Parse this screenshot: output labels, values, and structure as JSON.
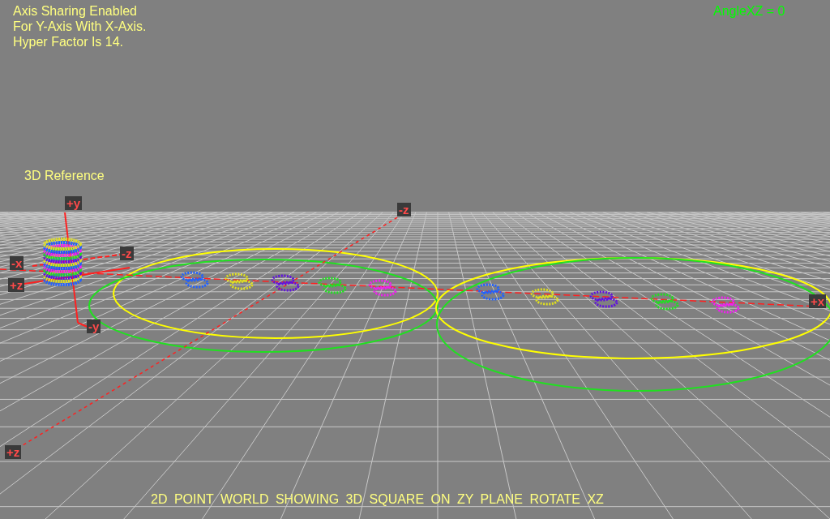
{
  "info_lines": [
    "Axis Sharing Enabled",
    "For Y-Axis With X-Axis.",
    "Hyper Factor Is 14."
  ],
  "angle_label": "AngleXZ = 0",
  "reference_label": "3D Reference",
  "axis_labels": [
    {
      "text": "+y"
    },
    {
      "text": "-z"
    },
    {
      "text": "-x"
    },
    {
      "text": "+z"
    },
    {
      "text": "-y"
    },
    {
      "text": "-z"
    },
    {
      "text": "+x"
    },
    {
      "text": "+z"
    }
  ],
  "caption": "2D POINT WORLD SHOWING 3D SQUARE ON ZY PLANE ROTATE XZ"
}
